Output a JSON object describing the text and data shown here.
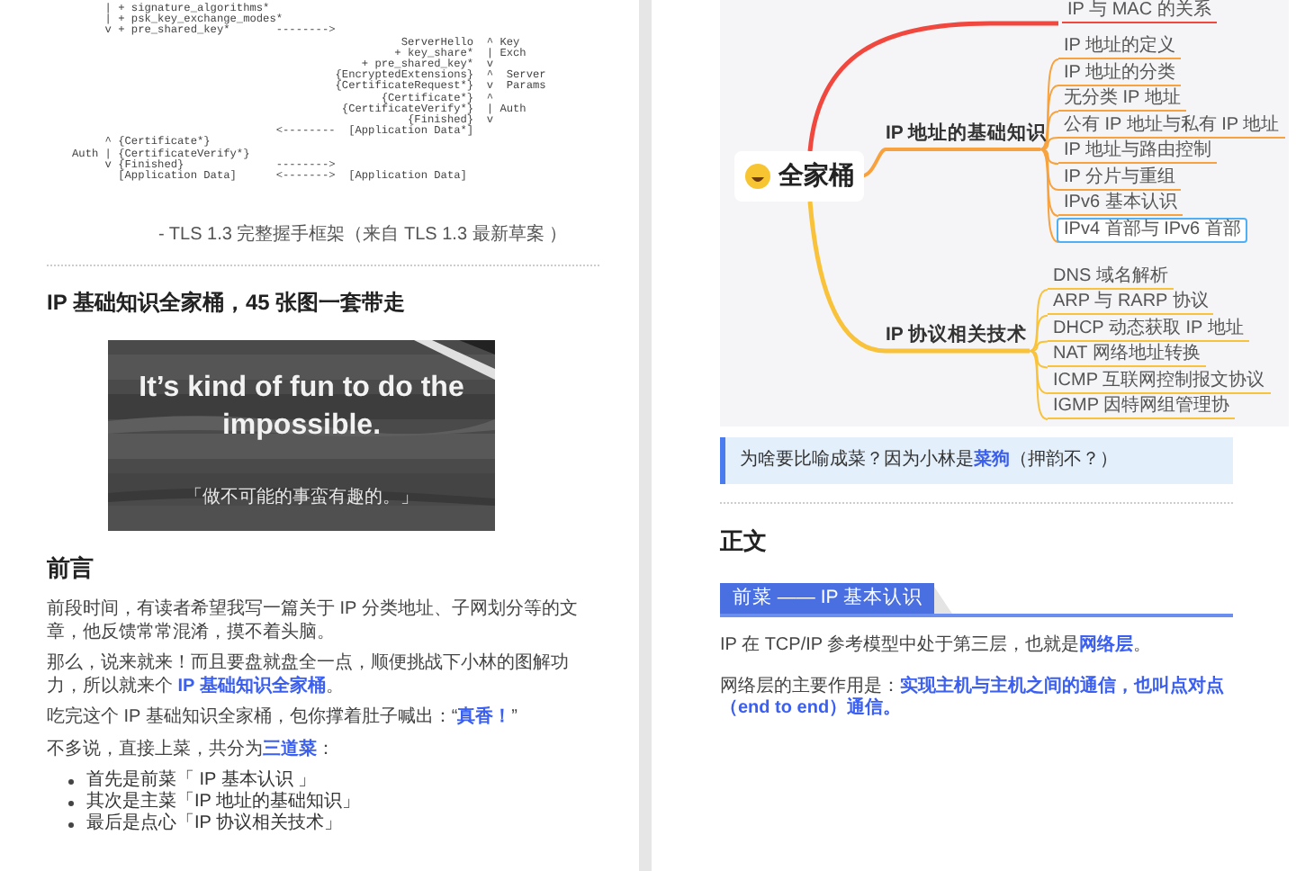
{
  "left_page": {
    "code_lines": [
      "     | + signature_algorithms*",
      "     | + psk_key_exchange_modes*",
      "     v + pre_shared_key*       -------->",
      "                                                  ServerHello  ^ Key",
      "                                                 + key_share*  | Exch",
      "                                            + pre_shared_key*  v",
      "                                        {EncryptedExtensions}  ^  Server",
      "                                        {CertificateRequest*}  v  Params",
      "                                               {Certificate*}  ^",
      "                                         {CertificateVerify*}  | Auth",
      "                                                   {Finished}  v",
      "                               <--------  [Application Data*]",
      "     ^ {Certificate*}",
      "Auth | {CertificateVerify*}",
      "     v {Finished}              -------->",
      "       [Application Data]      <------->  [Application Data]"
    ],
    "caption": "- TLS 1.3 完整握手框架（来自 TLS 1.3 最新草案 ）",
    "heading": "IP 基础知识全家桶，45 张图一套带走",
    "quote_image": {
      "kind": "picture",
      "quote": "It’s kind of fun to do the impossible.",
      "translation": "「做不可能的事蛮有趣的。」"
    },
    "section_title": "前言",
    "paragraphs": [
      [
        {
          "text": "前段时间，有读者希望我写一篇关于 IP 分类地址、子网划分等的文章，他反馈常常混淆，摸不着头脑。",
          "emphasis": false
        }
      ],
      [
        {
          "text": "那么，说来就来！而且要盘就盘全一点，顺便挑战下小林的图解功力，所以就来个 ",
          "emphasis": false
        },
        {
          "text": "IP 基础知识全家桶",
          "emphasis": true
        },
        {
          "text": "。",
          "emphasis": false
        }
      ],
      [
        {
          "text": "吃完这个 IP 基础知识全家桶，包你撑着肚子喊出：“",
          "emphasis": false
        },
        {
          "text": "真香！",
          "emphasis": true
        },
        {
          "text": "”",
          "emphasis": false
        }
      ],
      [
        {
          "text": "不多说，直接上菜，共分为",
          "emphasis": false
        },
        {
          "text": "三道菜",
          "emphasis": true
        },
        {
          "text": "：",
          "emphasis": false
        }
      ]
    ],
    "bullets": [
      "首先是前菜「 IP 基本认识 」",
      "其次是主菜「IP 地址的基础知识」",
      "最后是点心「IP 协议相关技术」"
    ]
  },
  "right_page": {
    "mind_map": {
      "root": "全家桶",
      "branches": [
        {
          "color": "#f0483e",
          "leaves": [
            {
              "label": "IP 与 MAC 的关系",
              "selected": false
            }
          ]
        },
        {
          "label": "IP 地址的基础知识",
          "color": "#f7a23e",
          "leaves": [
            {
              "label": "IP 地址的定义",
              "selected": false
            },
            {
              "label": "IP 地址的分类",
              "selected": false
            },
            {
              "label": "无分类 IP 地址",
              "selected": false
            },
            {
              "label": "公有 IP 地址与私有 IP 地址",
              "selected": false
            },
            {
              "label": "IP 地址与路由控制",
              "selected": false
            },
            {
              "label": "IP 分片与重组",
              "selected": false
            },
            {
              "label": "IPv6 基本认识",
              "selected": false
            },
            {
              "label": "IPv4 首部与 IPv6 首部",
              "selected": true
            }
          ]
        },
        {
          "label": "IP 协议相关技术",
          "color": "#f8c23a",
          "leaves": [
            {
              "label": "DNS 域名解析",
              "selected": false
            },
            {
              "label": "ARP 与 RARP 协议",
              "selected": false
            },
            {
              "label": "DHCP 动态获取 IP 地址",
              "selected": false
            },
            {
              "label": "NAT 网络地址转换",
              "selected": false
            },
            {
              "label": "ICMP 互联网控制报文协议",
              "selected": false
            },
            {
              "label": "IGMP 因特网组管理协",
              "selected": false
            }
          ]
        }
      ]
    },
    "note": [
      {
        "text": "为啥要比喻成菜？因为小林是",
        "emphasis": false
      },
      {
        "text": "菜狗",
        "emphasis": true
      },
      {
        "text": "（押韵不？）",
        "emphasis": false
      }
    ],
    "section_title": "正文",
    "banner": "前菜 —— IP 基本认识",
    "paragraphs": [
      [
        {
          "text": "IP 在 TCP/IP 参考模型中处于第三层，也就是",
          "emphasis": false
        },
        {
          "text": "网络层",
          "emphasis": true
        },
        {
          "text": "。",
          "emphasis": false
        }
      ],
      [
        {
          "text": "网络层的主要作用是：",
          "emphasis": false
        },
        {
          "text": "实现主机与主机之间的通信，也叫点对点（end to end）通信。",
          "emphasis": true
        }
      ]
    ]
  }
}
